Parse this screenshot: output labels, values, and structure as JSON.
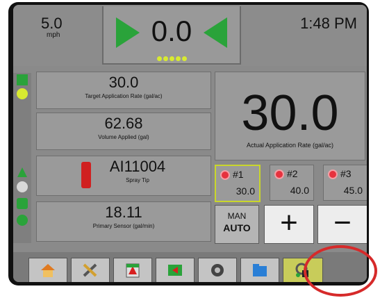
{
  "topbar": {
    "speed_value": "5.0",
    "speed_unit": "mph",
    "center_value": "0.0",
    "clock": "1:48 PM"
  },
  "panels": [
    {
      "value": "30.0",
      "label": "Target Application Rate (gal/ac)"
    },
    {
      "value": "62.68",
      "label": "Volume Applied (gal)"
    },
    {
      "value": "AI11004",
      "label": "Spray Tip"
    },
    {
      "value": "18.11",
      "label": "Primary Sensor (gal/min)"
    }
  ],
  "actual_rate": {
    "value": "30.0",
    "label": "Actual Application Rate (gal/ac)"
  },
  "booms": [
    {
      "name": "#1",
      "rate": "30.0"
    },
    {
      "name": "#2",
      "rate": "40.0"
    },
    {
      "name": "#3",
      "rate": "45.0"
    }
  ],
  "controls": {
    "man": "MAN",
    "auto": "AUTO",
    "plus": "+",
    "minus": "−"
  },
  "bottom_tabs": [
    "home-icon",
    "tools-icon",
    "field-icon",
    "map-icon",
    "camera-icon",
    "folder-icon",
    "rate-settings-icon"
  ],
  "colors": {
    "accent_green": "#2aa33a",
    "dot_yellow": "#d8ea30",
    "highlight_red": "#d62a2a"
  }
}
